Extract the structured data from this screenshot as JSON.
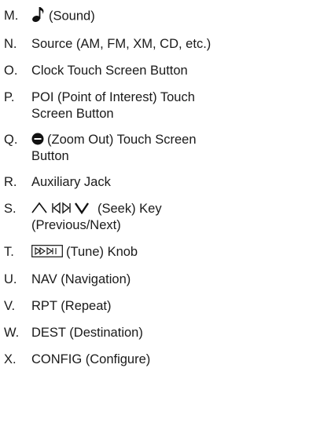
{
  "items": [
    {
      "letter": "M.",
      "icon": "musical-note-icon",
      "text": "(Sound)"
    },
    {
      "letter": "N.",
      "text": "Source (AM, FM, XM, CD, etc.)"
    },
    {
      "letter": "O.",
      "text": "Clock Touch Screen Button"
    },
    {
      "letter": "P.",
      "text_line1": "POI (Point of Interest) Touch",
      "text_line2": "Screen Button"
    },
    {
      "letter": "Q.",
      "icon": "zoom-out-icon",
      "text_line1": "(Zoom Out) Touch Screen",
      "text_line2": "Button"
    },
    {
      "letter": "R.",
      "text": "Auxiliary Jack"
    },
    {
      "letter": "S.",
      "icon": "seek-keys-icon",
      "text_line1": "(Seek) Key",
      "text_line2": "(Previous/Next)"
    },
    {
      "letter": "T.",
      "icon": "tune-knob-icon",
      "text": "(Tune) Knob"
    },
    {
      "letter": "U.",
      "text": "NAV (Navigation)"
    },
    {
      "letter": "V.",
      "text": "RPT (Repeat)"
    },
    {
      "letter": "W.",
      "text": "DEST (Destination)"
    },
    {
      "letter": "X.",
      "text": "CONFIG (Configure)"
    }
  ]
}
